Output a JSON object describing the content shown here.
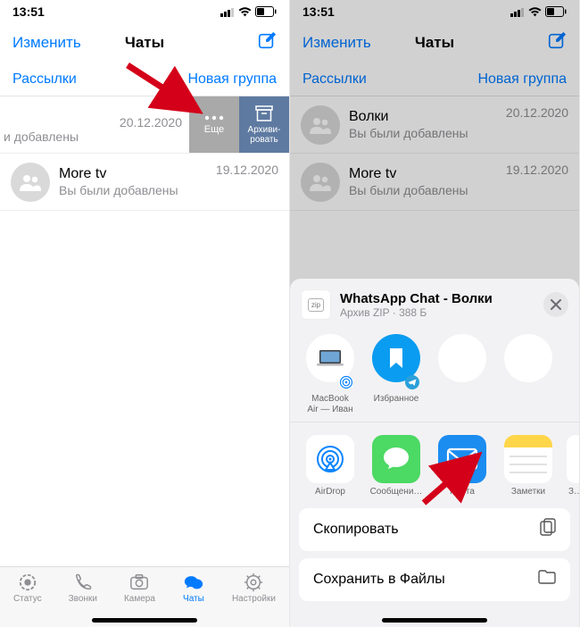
{
  "status": {
    "time": "13:51"
  },
  "nav": {
    "edit": "Изменить",
    "title": "Чаты"
  },
  "toolbar": {
    "broadcasts": "Рассылки",
    "newGroup": "Новая группа"
  },
  "chats": [
    {
      "name": "Волки",
      "sub": "Вы были добавлены",
      "subCut": "и добавлены",
      "date": "20.12.2020"
    },
    {
      "name": "More tv",
      "sub": "Вы были добавлены",
      "date": "19.12.2020"
    }
  ],
  "swipe": {
    "more": "Еще",
    "archive": "Архиви-\nровать"
  },
  "tabs": {
    "status": "Статус",
    "calls": "Звонки",
    "camera": "Камера",
    "chats": "Чаты",
    "settings": "Настройки"
  },
  "share": {
    "title": "WhatsApp Chat - Волки",
    "meta": "Архив ZIP · 388 Б",
    "fileBadge": "zip",
    "targetsTop": [
      {
        "id": "macbook",
        "label": "MacBook\nAir — Иван"
      },
      {
        "id": "favorites",
        "label": "Избранное"
      },
      {
        "id": "blank1",
        "label": ""
      },
      {
        "id": "blank2",
        "label": ""
      }
    ],
    "apps": [
      {
        "id": "airdrop",
        "label": "AirDrop"
      },
      {
        "id": "messages",
        "label": "Сообщени…"
      },
      {
        "id": "mail",
        "label": "Почта"
      },
      {
        "id": "notes",
        "label": "Заметки"
      },
      {
        "id": "extra",
        "label": "З…"
      }
    ],
    "actions": {
      "copy": "Скопировать",
      "saveFiles": "Сохранить в Файлы"
    }
  }
}
